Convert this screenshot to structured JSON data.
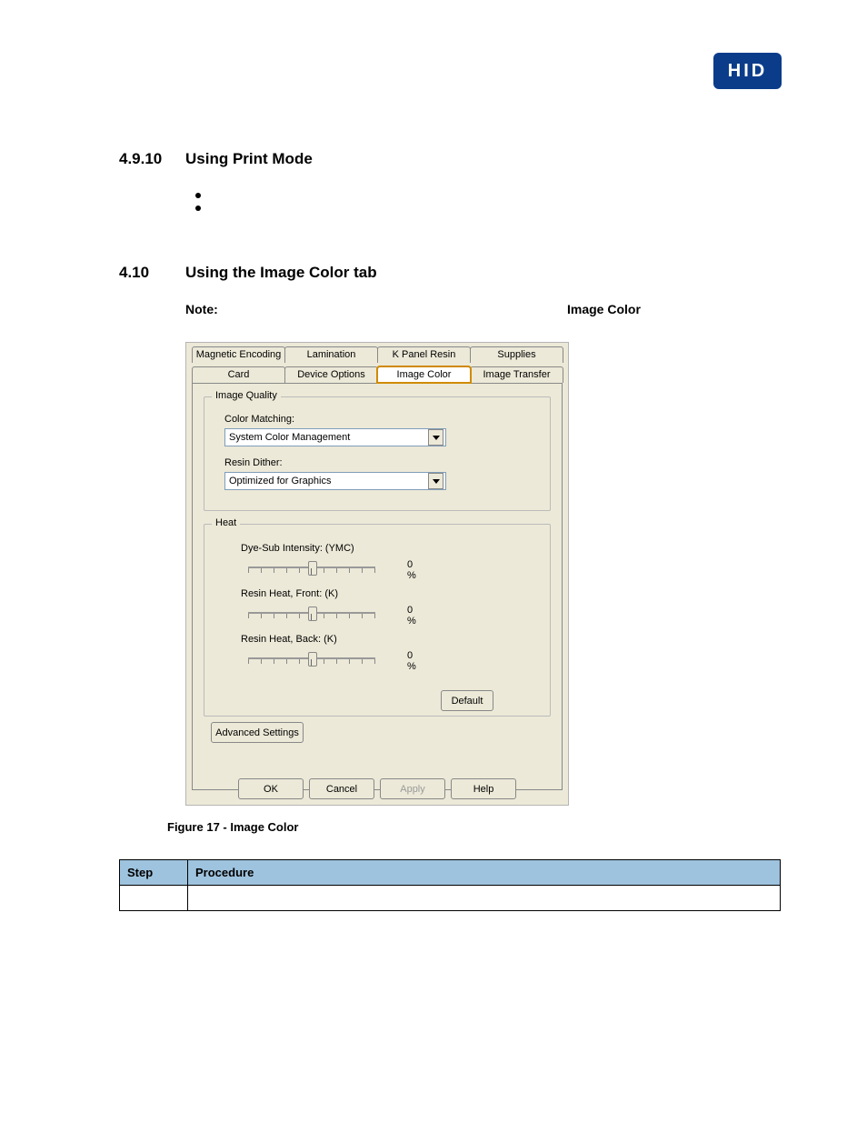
{
  "logo_text": "HID",
  "section1": {
    "num": "4.9.10",
    "title": "Using Print Mode"
  },
  "section2": {
    "num": "4.10",
    "title": "Using the Image Color tab"
  },
  "note": {
    "label": "Note:",
    "label2": "Image Color"
  },
  "dialog": {
    "tabs_top": [
      "Magnetic Encoding",
      "Lamination",
      "K Panel Resin",
      "Supplies"
    ],
    "tabs_bottom": [
      "Card",
      "Device Options",
      "Image Color",
      "Image Transfer"
    ],
    "group1_title": "Image Quality",
    "color_matching_label": "Color Matching:",
    "color_matching_value": "System Color Management",
    "resin_dither_label": "Resin Dither:",
    "resin_dither_value": "Optimized for Graphics",
    "group2_title": "Heat",
    "sliders": [
      {
        "label": "Dye-Sub Intensity:  (YMC)",
        "value": "0 %"
      },
      {
        "label": "Resin Heat, Front: (K)",
        "value": "0 %"
      },
      {
        "label": "Resin Heat, Back:    (K)",
        "value": "0 %"
      }
    ],
    "default_btn": "Default",
    "advanced_btn": "Advanced Settings",
    "ok_btn": "OK",
    "cancel_btn": "Cancel",
    "apply_btn": "Apply",
    "help_btn": "Help"
  },
  "figure_caption": "Figure 17 - Image Color",
  "table": {
    "head_step": "Step",
    "head_proc": "Procedure"
  }
}
